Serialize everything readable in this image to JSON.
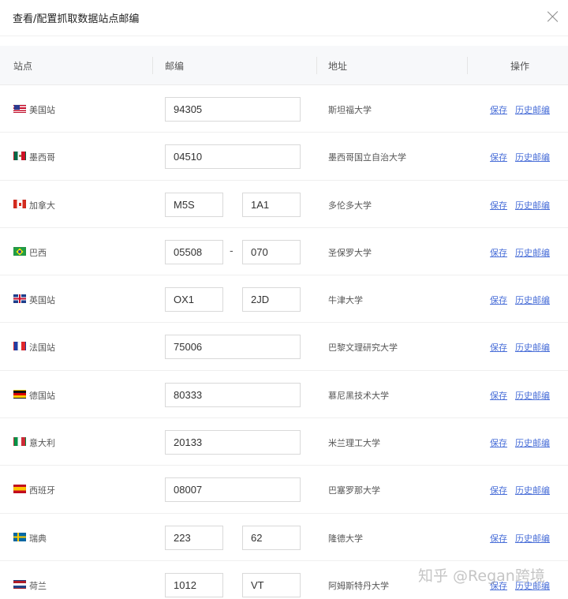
{
  "dialog": {
    "title": "查看/配置抓取数据站点邮编"
  },
  "table": {
    "headers": {
      "site": "站点",
      "zip": "邮编",
      "address": "地址",
      "actions": "操作"
    },
    "rows": [
      {
        "flag": "us-flag-icon",
        "site": "美国站",
        "zip": [
          "94305"
        ],
        "address": "斯坦福大学",
        "save": "保存",
        "history": "历史邮编"
      },
      {
        "flag": "mexico-flag-icon",
        "site": "墨西哥",
        "zip": [
          "04510"
        ],
        "address": "墨西哥国立自治大学",
        "save": "保存",
        "history": "历史邮编"
      },
      {
        "flag": "canada-flag-icon",
        "site": "加拿大",
        "zip": [
          "M5S",
          "1A1"
        ],
        "address": "多伦多大学",
        "save": "保存",
        "history": "历史邮编"
      },
      {
        "flag": "brazil-flag-icon",
        "site": "巴西",
        "zip": [
          "05508",
          "070"
        ],
        "separator": "-",
        "address": "圣保罗大学",
        "save": "保存",
        "history": "历史邮编"
      },
      {
        "flag": "uk-flag-icon",
        "site": "英国站",
        "zip": [
          "OX1",
          "2JD"
        ],
        "address": "牛津大学",
        "save": "保存",
        "history": "历史邮编"
      },
      {
        "flag": "france-flag-icon",
        "site": "法国站",
        "zip": [
          "75006"
        ],
        "address": "巴黎文理研究大学",
        "save": "保存",
        "history": "历史邮编"
      },
      {
        "flag": "germany-flag-icon",
        "site": "德国站",
        "zip": [
          "80333"
        ],
        "address": "慕尼黑技术大学",
        "save": "保存",
        "history": "历史邮编"
      },
      {
        "flag": "italy-flag-icon",
        "site": "意大利",
        "zip": [
          "20133"
        ],
        "address": "米兰理工大学",
        "save": "保存",
        "history": "历史邮编"
      },
      {
        "flag": "spain-flag-icon",
        "site": "西班牙",
        "zip": [
          "08007"
        ],
        "address": "巴塞罗那大学",
        "save": "保存",
        "history": "历史邮编"
      },
      {
        "flag": "sweden-flag-icon",
        "site": "瑞典",
        "zip": [
          "223",
          "62"
        ],
        "address": "隆德大学",
        "save": "保存",
        "history": "历史邮编"
      },
      {
        "flag": "netherlands-flag-icon",
        "site": "荷兰",
        "zip": [
          "1012",
          "VT"
        ],
        "address": "阿姆斯特丹大学",
        "save": "保存",
        "history": "历史邮编"
      }
    ]
  },
  "watermark": "知乎 @Regan跨境"
}
